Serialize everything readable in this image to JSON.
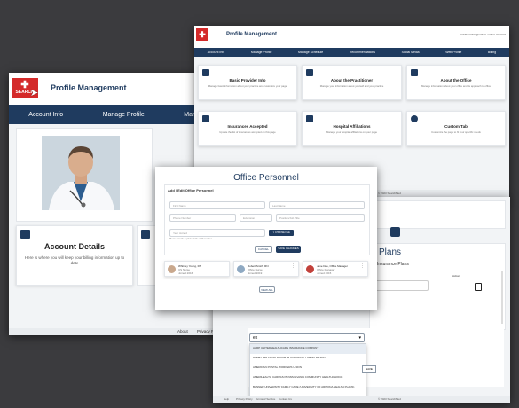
{
  "colors": {
    "navy": "#1f3b5f",
    "brand_red": "#d42a2a",
    "background": "#3b3b3e"
  },
  "logo": {
    "text": "SEARCH",
    "icon": "cross-icon"
  },
  "profile_window": {
    "title": "Profile Management",
    "nav": [
      "Account Info",
      "Manage Profile",
      "Manage Sc"
    ],
    "account_title": "Account Details",
    "account_text": "Here is where you will keep your billing information up to date",
    "footer": [
      "About",
      "Privacy Po"
    ]
  },
  "provider_window": {
    "title": "Profile Management",
    "top_right": "SOMETHING@GMAIL.COM  LOGOUT",
    "nav": [
      "Account Info",
      "Manage Profile",
      "Manage Schedule",
      "Recommendations",
      "Social Media",
      "Web Profile",
      "Billing"
    ],
    "cards": [
      {
        "title": "Basic Provider Info",
        "text": "Manage basic information about your practice and customize your page",
        "icon": "user-icon"
      },
      {
        "title": "About the Practitioner",
        "text": "Manage your information about yourself and your practice",
        "icon": "document-icon"
      },
      {
        "title": "About the Office",
        "text": "Manage information about your office and its approach to office",
        "icon": "phone-icon"
      },
      {
        "title": "Insurances Accepted",
        "text": "Update the list of insurances accepted on this page",
        "icon": "check-icon"
      },
      {
        "title": "Hospital Affiliations",
        "text": "Manage your hospital affiliations on your page",
        "icon": "hospital-icon"
      },
      {
        "title": "Custom Tab",
        "text": "Customize the page to fit your specific needs",
        "icon": "gear-icon"
      }
    ],
    "footer_text": "© 2023 SearchMed"
  },
  "personnel_window": {
    "title": "Office Personnel",
    "section": "Add / Edit Office Personnel",
    "placeholders": [
      "First Name",
      "Last Name",
      "Phone Number",
      "Extension",
      "Position/Job Title",
      "Year Joined"
    ],
    "hint": "Please provide a photo of the staff member",
    "choose_file": "CHOOSE FILE",
    "cancel": "CANCEL",
    "save": "SAVE CHANGES",
    "personnel": [
      {
        "name": "Whitney Young, RN",
        "role": "US Nurse",
        "meta": "Joined 2016"
      },
      {
        "name": "Robert Smith, RN",
        "role": "Office Nurse",
        "meta": "Joined 2019"
      },
      {
        "name": "Jane Doe, Office Manager",
        "role": "Office Manager",
        "meta": "Joined 2015"
      }
    ],
    "view_all": "VIEW ALL"
  },
  "insurance_window": {
    "title": "Plans",
    "subtitle": "Insurance Plans",
    "col_action": "Action",
    "select_value": "ex",
    "footer_links": [
      "Help",
      "Privacy Policy",
      "Terms of Service",
      "Contact Us"
    ],
    "footer_right": "© 2023 SearchMed",
    "options": [
      "AARP UNITEDHEALTHCARE INSURANCE COMPANY",
      "AMBETTER FROM BUCKEYE COMMUNITY HEALTH PLAN",
      "AMERICAN POSTAL WORKERS UNION",
      "AMERIHEALTH CARITAS PENNSYLVANIA COMMUNITY HEALTHCHOICE",
      "BANNER UNIVERSITY FAMILY CARE (UNIVERSITY OF ARIZONA HEALTH PLANS)",
      "BETTER HEALTH PLAN ALLIANCE"
    ],
    "save": "SAVE"
  }
}
